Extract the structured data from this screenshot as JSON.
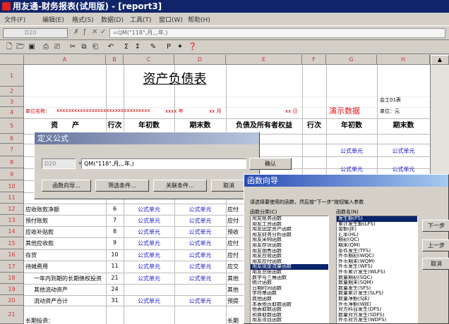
{
  "window": {
    "title": "用友通-财务报表(试用版) - [report3]"
  },
  "menu": [
    {
      "label": "文件(F)"
    },
    {
      "label": "编辑(E)"
    },
    {
      "label": "格式(S)"
    },
    {
      "label": "数据(D)"
    },
    {
      "label": "工具(T)"
    },
    {
      "label": "窗口(W)"
    },
    {
      "label": "帮助(H)"
    }
  ],
  "formula_bar": {
    "cell_ref": "D20",
    "content": "=QM(\"118\",月,,,年,)"
  },
  "toolbar": {
    "tools": [
      "new-file",
      "open-folder",
      "save",
      "print-preview",
      "print",
      "cut",
      "copy",
      "paste",
      "undo",
      "sum",
      "sort",
      "format-painter",
      "insert-chart",
      "paint",
      "help"
    ]
  },
  "grid": {
    "columns": [
      "A",
      "B",
      "C",
      "D",
      "E",
      "F",
      "G",
      "H"
    ],
    "rows": [
      "1",
      "2",
      "3",
      "4",
      "5",
      "6",
      "7",
      "8",
      "9",
      "10",
      "11",
      "12",
      "13",
      "14",
      "15",
      "16",
      "17",
      "18",
      "19",
      "20",
      "21"
    ],
    "title": "资产负债表",
    "company_label": "单位名称：",
    "masked_company": "xxxxxxxxxxxxxxxxxxxxxxxxxxxxxxxx",
    "year_label": "xxxx 年",
    "month_label": "xx 月",
    "day_label": "xx 日",
    "demo_data": "演示数据",
    "form_no": "会工01表",
    "unit": "单位：元",
    "headers": {
      "assets": "资　　产",
      "line_no": "行次",
      "begin": "年初数",
      "end": "期末数",
      "liab": "负债及所有者权益",
      "line_no2": "行次",
      "begin2": "年初数",
      "end2": "期末数"
    },
    "left_rows": [
      {
        "name": "应收账款净额",
        "line": "6",
        "begin": "公式单元",
        "end": "公式单元"
      },
      {
        "name": "预付账款",
        "line": "7",
        "begin": "公式单元",
        "end": "公式单元"
      },
      {
        "name": "应收补贴款",
        "line": "8",
        "begin": "公式单元",
        "end": "公式单元"
      },
      {
        "name": "其他应收款",
        "line": "9",
        "begin": "公式单元",
        "end": "公式单元"
      },
      {
        "name": "存货",
        "line": "10",
        "begin": "公式单元",
        "end": "公式单元"
      },
      {
        "name": "待摊费用",
        "line": "11",
        "begin": "公式单元",
        "end": "公式单元"
      },
      {
        "name": "一年内到期的长期债权投资",
        "line": "21",
        "begin": "公式单元",
        "end": "公式单元"
      },
      {
        "name": "其他流动资产",
        "line": "24",
        "begin": "",
        "end": ""
      },
      {
        "name": "流动资产合计",
        "line": "31",
        "begin": "公式单元",
        "end": "公式单元"
      }
    ],
    "right_trunc": [
      "应付",
      "应付",
      "预收",
      "应付",
      "应付",
      "应交",
      "其他",
      "其他",
      "预提"
    ],
    "right_formula_rows": [
      "公式单元",
      "公式单元"
    ],
    "longterm_label": "长期投资：",
    "longterm_right": "长期"
  },
  "define_formula_dialog": {
    "title": "定义公式",
    "cell_ref": "D20",
    "formula": "QM(\"118\",月,,,年,)",
    "ok": "确认",
    "cancel": "取消",
    "func_wizard": "函数向导...",
    "filter": "筛选条件...",
    "relation": "关联条件..."
  },
  "function_wizard": {
    "title": "函数向导",
    "instruction": "请选择要使用的函数，然后按“下一步”按钮输入参数",
    "category_label": "函数分类(C)",
    "name_label": "函数名(N)",
    "categories": [
      "用友账务函数",
      "用友工资函数",
      "用友固定资产函数",
      "用友财务分析函数",
      "用友采购函数",
      "用友存货函数",
      "用友销售函数",
      "用友应收函数",
      "用友应付函数",
      "用友现金流量函数",
      "用友总账函数",
      "数学与三角函数",
      "统计函数",
      "日期时间函数",
      "字符串函数",
      "其他函数",
      "本表他页取数函数",
      "他表取数函数",
      "预算取数函数",
      "用友项目函数"
    ],
    "selected_category": 9,
    "functions": [
      "发生额(FS)",
      "累计发生额(LFS)",
      "金额(JE)",
      "汇率(HL)",
      "期初(QC)",
      "期末(QM)",
      "条件发生(TFS)",
      "外币期初(WQC)",
      "外币期末(WQM)",
      "外币发生(WFS)",
      "外币累计发生(WLFS)",
      "数量期初(SQC)",
      "数量期末(SQM)",
      "数量发生(SFS)",
      "数量累计发生(SLFS)",
      "数量净额(SJE)",
      "外币净额(WJE)",
      "对方科目发生(DFS)",
      "数量对方发生(SDFS)",
      "外币对方发生(WDFS)"
    ],
    "selected_function": 0,
    "btn_next": "下一步",
    "btn_cancel": "取消",
    "btn_back": "上一步"
  }
}
